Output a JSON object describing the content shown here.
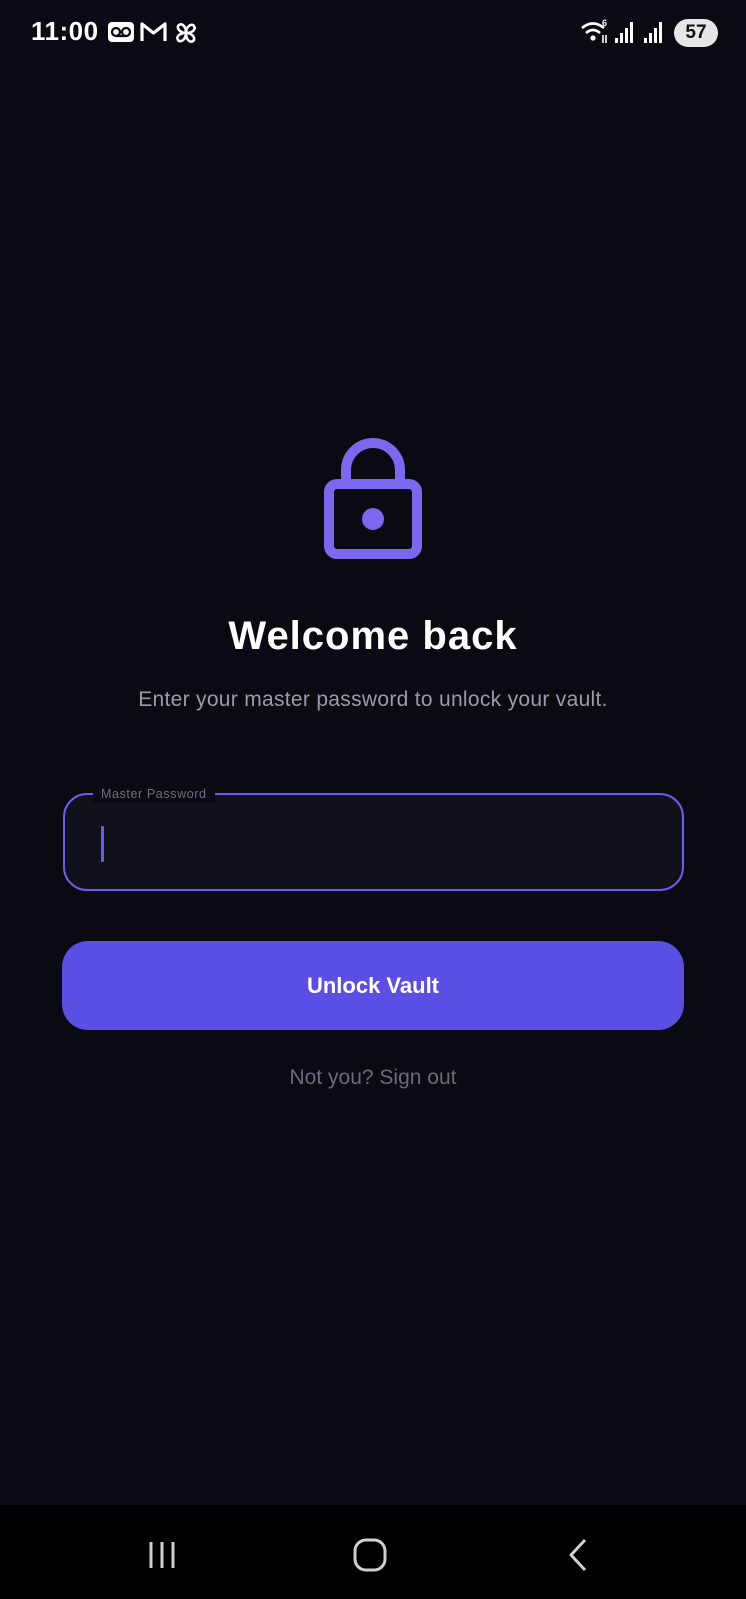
{
  "status_bar": {
    "time": "11:00",
    "icons": [
      "voicemail-icon",
      "gmail-icon",
      "pinwheel-icon",
      "wifi-icon",
      "signal-icon",
      "signal-icon"
    ],
    "battery": "57"
  },
  "lock": {
    "icon": "lock-icon",
    "color": "#7b68ee"
  },
  "title": "Welcome back",
  "subtitle": "Enter your master password to unlock your vault.",
  "password_field": {
    "label": "Master Password",
    "value": "",
    "accent": "#6a5cf0"
  },
  "unlock_button": {
    "label": "Unlock Vault",
    "color": "#5b4ee4"
  },
  "signout_link": "Not you? Sign out",
  "nav_bar": {
    "buttons": [
      "recent-apps-icon",
      "home-icon",
      "back-icon"
    ]
  }
}
